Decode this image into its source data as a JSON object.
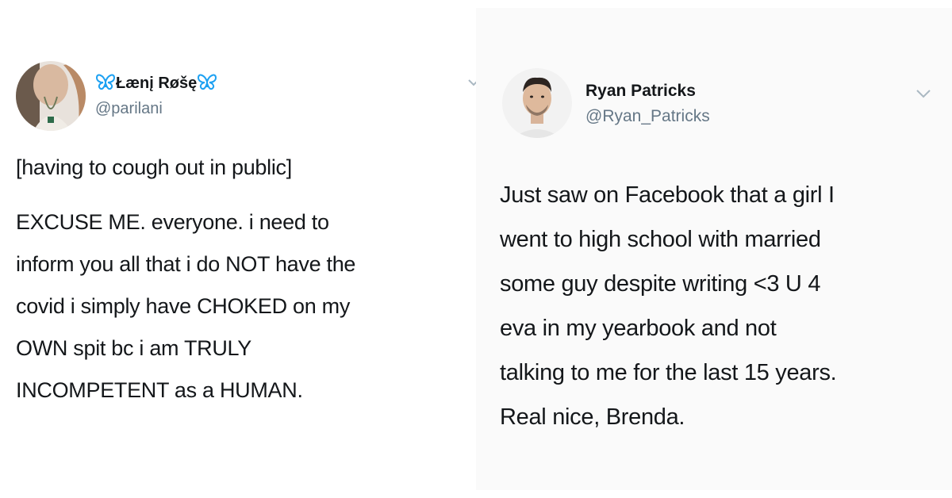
{
  "tweets": [
    {
      "display_name": "Łænį Røšę",
      "name_decoration_icon": "butterfly-icon",
      "handle": "@parilani",
      "text_lines": [
        "[having to cough out in public]",
        "EXCUSE ME. everyone. i need to",
        "inform you all that i do NOT have the",
        "covid i simply have CHOKED on my",
        "OWN spit bc i am TRULY",
        "INCOMPETENT as a HUMAN."
      ],
      "menu_icon": "chevron-down-icon"
    },
    {
      "display_name": "Ryan Patricks",
      "handle": "@Ryan_Patricks",
      "text_lines": [
        "Just saw on Facebook that a girl I",
        "went to high school with married",
        "some guy despite writing <3 U 4",
        "eva in my yearbook and not",
        "talking to me for the last 15 years.",
        "Real nice, Brenda."
      ],
      "menu_icon": "chevron-down-icon"
    }
  ],
  "colors": {
    "text": "#14171a",
    "handle": "#657786",
    "butterfly": "#1da1f2",
    "chevron": "#aab8c2"
  }
}
